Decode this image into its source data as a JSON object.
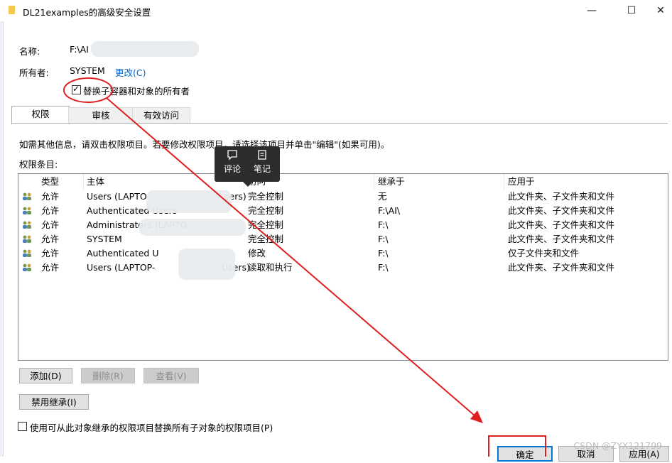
{
  "window": {
    "title": "DL21examples的高级安全设置",
    "minimize": "—",
    "maximize": "☐",
    "close": "✕"
  },
  "info": {
    "name_label": "名称:",
    "name_value": "F:\\AI",
    "owner_label": "所有者:",
    "owner_value": "SYSTEM",
    "change_link": "更改(C)",
    "replace_owner_checkbox": "替换子容器和对象的所有者",
    "replace_owner_checked": true
  },
  "tabs": [
    "权限",
    "审核",
    "有效访问"
  ],
  "permissions": {
    "info_text": "如需其他信息，请双击权限项目。若要修改权限项目，请选择该项目并单击\"编辑\"(如果可用)。",
    "entries_label": "权限条目:",
    "columns": [
      "类型",
      "主体",
      "访问",
      "继承于",
      "应用于"
    ],
    "rows": [
      {
        "type": "允许",
        "principal": "Users (LAPTO",
        "principal_tail": "sers)",
        "access": "完全控制",
        "inherited": "无",
        "applies": "此文件夹、子文件夹和文件"
      },
      {
        "type": "允许",
        "principal": "Authenticated Users",
        "principal_tail": "",
        "access": "完全控制",
        "inherited": "F:\\AI\\",
        "applies": "此文件夹、子文件夹和文件"
      },
      {
        "type": "允许",
        "principal": "Administrators (LAPTO",
        "principal_tail": "",
        "access": "完全控制",
        "inherited": "F:\\",
        "applies": "此文件夹、子文件夹和文件"
      },
      {
        "type": "允许",
        "principal": "SYSTEM",
        "principal_tail": "",
        "access": "完全控制",
        "inherited": "F:\\",
        "applies": "此文件夹、子文件夹和文件"
      },
      {
        "type": "允许",
        "principal": "Authenticated U",
        "principal_tail": "",
        "access": "修改",
        "inherited": "F:\\",
        "applies": "仅子文件夹和文件"
      },
      {
        "type": "允许",
        "principal": "Users (LAPTOP-",
        "principal_tail": "Users)",
        "access": "读取和执行",
        "inherited": "F:\\",
        "applies": "此文件夹、子文件夹和文件"
      }
    ]
  },
  "buttons": {
    "add": "添加(D)",
    "remove": "删除(R)",
    "view": "查看(V)",
    "disable_inheritance": "禁用继承(I)",
    "replace_child_checkbox": "使用可从此对象继承的权限项目替换所有子对象的权限项目(P)",
    "ok": "确定",
    "cancel": "取消",
    "apply": "应用(A)"
  },
  "popup": {
    "comment": "评论",
    "note": "笔记"
  },
  "watermark": "CSDN @ZYX121799",
  "colors": {
    "annotation": "#e02020",
    "link": "#0066cc",
    "accent": "#0078d7"
  }
}
